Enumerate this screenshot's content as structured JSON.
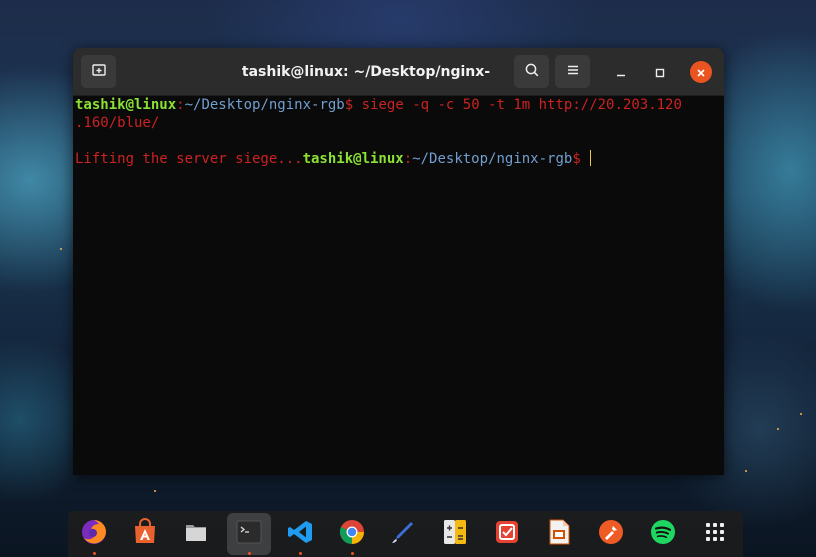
{
  "window": {
    "title": "tashik@linux: ~/Desktop/nginx-rgb",
    "new_tab_icon": "new-tab-icon",
    "search_icon": "search-icon",
    "menu_icon": "hamburger-menu-icon",
    "minimize_icon": "minimize-icon",
    "maximize_icon": "maximize-icon",
    "close_icon": "close-icon"
  },
  "terminal": {
    "line1": {
      "user_host": "tashik@linux",
      "sep": ":",
      "path": "~/Desktop/nginx-rgb",
      "dollar": "$",
      "command_part1": " siege -q -c 50 -t 1m http://20.203.120"
    },
    "line2": ".160/blue/",
    "line3": {
      "output": "Lifting the server siege...",
      "user_host": "tashik@linux",
      "sep": ":",
      "path": "~/Desktop/nginx-rgb",
      "dollar": "$ "
    }
  },
  "dock": {
    "apps": [
      {
        "name": "Firefox",
        "icon": "firefox-icon",
        "running": true
      },
      {
        "name": "Ubuntu Software",
        "icon": "software-store-icon",
        "running": false
      },
      {
        "name": "Files",
        "icon": "files-icon",
        "running": false
      },
      {
        "name": "Terminal",
        "icon": "terminal-icon",
        "running": true,
        "active": true
      },
      {
        "name": "Visual Studio Code",
        "icon": "vscode-icon",
        "running": true
      },
      {
        "name": "Google Chrome",
        "icon": "chrome-icon",
        "running": true
      },
      {
        "name": "Inkscape",
        "icon": "pen-icon",
        "running": false
      },
      {
        "name": "Calculator",
        "icon": "calculator-icon",
        "running": false
      },
      {
        "name": "Todoist",
        "icon": "todo-icon",
        "running": false
      },
      {
        "name": "LibreOffice Impress",
        "icon": "presentation-icon",
        "running": false
      },
      {
        "name": "Postman",
        "icon": "postman-icon",
        "running": false
      },
      {
        "name": "Spotify",
        "icon": "spotify-icon",
        "running": false
      },
      {
        "name": "Show Applications",
        "icon": "app-grid-icon",
        "running": false
      }
    ]
  },
  "colors": {
    "prompt_user": "#8ae234",
    "prompt_path": "#729fcf",
    "command_text": "#cc2222",
    "close_button": "#e95420",
    "running_dot": "#e95420"
  }
}
